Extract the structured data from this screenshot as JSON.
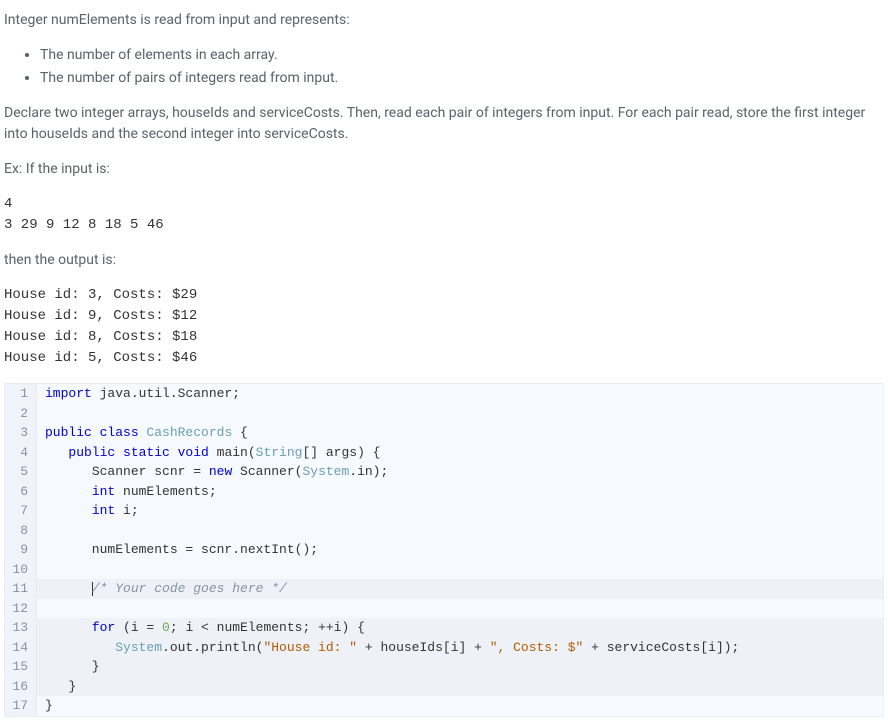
{
  "description": {
    "intro": "Integer numElements is read from input and represents:",
    "bullets": [
      "The number of elements in each array.",
      "The number of pairs of integers read from input."
    ],
    "instructions": "Declare two integer arrays, houseIds and serviceCosts. Then, read each pair of integers from input. For each pair read, store the first integer into houseIds and the second integer into serviceCosts.",
    "ex_label": "Ex: If the input is:",
    "example_input": "4\n3 29 9 12 8 18 5 46",
    "then_label": "then the output is:",
    "example_output": "House id: 3, Costs: $29\nHouse id: 9, Costs: $12\nHouse id: 8, Costs: $18\nHouse id: 5, Costs: $46"
  },
  "code": {
    "line1_import": "import",
    "line1_rest": " java.util.Scanner;",
    "line3_public": "public",
    "line3_class": " class",
    "line3_name": " CashRecords ",
    "line3_brace": "{",
    "line4_indent": "   ",
    "line4_public": "public",
    "line4_static": " static",
    "line4_void": " void",
    "line4_main": " main(",
    "line4_string": "String",
    "line4_args": "[] args) {",
    "line5_indent": "      ",
    "line5_scanner1": "Scanner scnr = ",
    "line5_new": "new",
    "line5_scanner2": " Scanner(",
    "line5_system": "System",
    "line5_in": ".in);",
    "line6_indent": "      ",
    "line6_int": "int",
    "line6_var": " numElements;",
    "line7_indent": "      ",
    "line7_int": "int",
    "line7_var": " i;",
    "line9_text": "      numElements = scnr.nextInt();",
    "line11_indent": "      ",
    "line11_comment": "/* Your code goes here */",
    "line13_indent": "      ",
    "line13_for": "for",
    "line13_open": " (i = ",
    "line13_zero": "0",
    "line13_rest": "; i < numElements; ++i) {",
    "line14_indent": "         ",
    "line14_sys": "System",
    "line14_out": ".out.println(",
    "line14_str1": "\"House id: \"",
    "line14_mid1": " + houseIds[i] + ",
    "line14_str2": "\", Costs: $\"",
    "line14_mid2": " + serviceCosts[i]);",
    "line15_text": "      }",
    "line16_text": "   }",
    "line17_text": "}"
  },
  "line_numbers": [
    "1",
    "2",
    "3",
    "4",
    "5",
    "6",
    "7",
    "8",
    "9",
    "10",
    "11",
    "12",
    "13",
    "14",
    "15",
    "16",
    "17"
  ]
}
